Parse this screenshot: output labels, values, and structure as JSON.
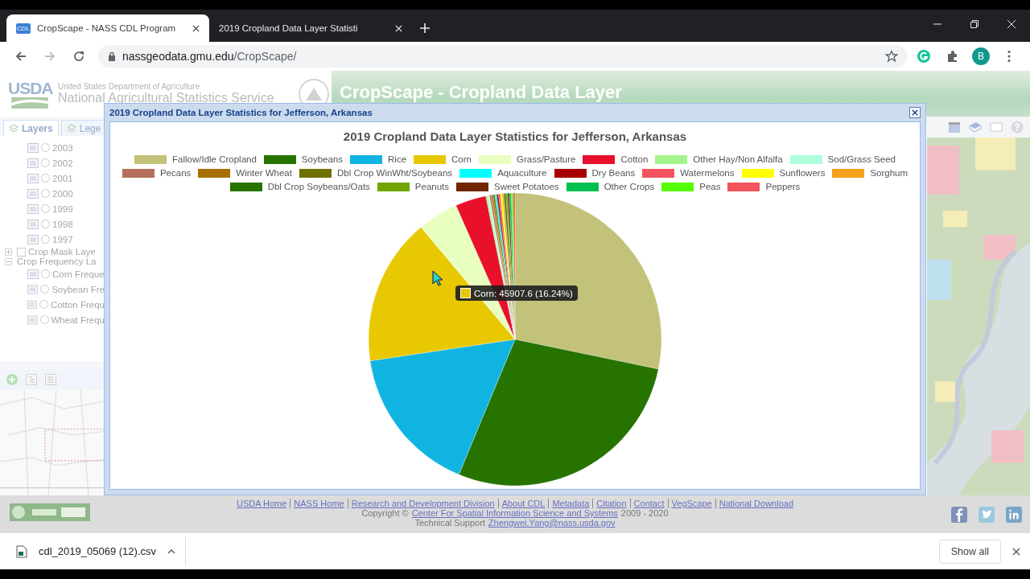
{
  "browser": {
    "tabs": [
      {
        "title": "CropScape - NASS CDL Program",
        "selected": true,
        "favicon": "CDL"
      },
      {
        "title": "2019 Cropland Data Layer Statisti",
        "selected": false
      }
    ],
    "url": {
      "host": "nassgeodata.gmu.edu",
      "path": "/CropScape/"
    },
    "profile_initial": "B"
  },
  "page": {
    "logo": "USDA",
    "agency": "United States Department of Agriculture",
    "service": "National Agricultural Statistics Service",
    "app_title": "CropScape - Cropland Data Layer",
    "panel_tabs": [
      {
        "label": "Layers",
        "selected": true
      },
      {
        "label": "Lege",
        "selected": false
      }
    ],
    "layers": [
      {
        "kind": "layer",
        "label": "2003",
        "checked": false
      },
      {
        "kind": "layer",
        "label": "2002",
        "checked": false
      },
      {
        "kind": "layer",
        "label": "2001",
        "checked": false
      },
      {
        "kind": "layer",
        "label": "2000",
        "checked": false
      },
      {
        "kind": "layer",
        "label": "1999",
        "checked": false
      },
      {
        "kind": "layer",
        "label": "1998",
        "checked": false
      },
      {
        "kind": "layer",
        "label": "1997",
        "checked": false
      },
      {
        "kind": "folder",
        "label": "Crop Mask Laye",
        "expanded": false,
        "checked": false
      },
      {
        "kind": "folder",
        "label": "Crop Frequency La",
        "expanded": true,
        "children": [
          {
            "kind": "layer",
            "label": "Corn Freque",
            "checked": false
          },
          {
            "kind": "layer",
            "label": "Soybean Fre",
            "checked": false
          },
          {
            "kind": "layer",
            "label": "Cotton Frequ",
            "checked": false
          },
          {
            "kind": "layer",
            "label": "Wheat Frequ",
            "checked": false
          }
        ]
      }
    ],
    "footer": {
      "links": [
        "USDA Home",
        "NASS Home",
        "Research and Development Division",
        "About CDL",
        "Metadata",
        "Citation",
        "Contact",
        "VegScape",
        "National Download"
      ],
      "copyright": "Copyright ©",
      "copyright_link": "Center For Spatial Information Science and Systems",
      "years": "2009 - 2020",
      "support": "Technical Support",
      "support_email": "Zhengwei.Yang@nass.usda.gov"
    }
  },
  "dialog": {
    "title": "2019 Cropland Data Layer Statistics for Jefferson, Arkansas",
    "chart_data": {
      "type": "pie",
      "title": "2019 Cropland Data Layer Statistics for Jefferson, Arkansas",
      "categories": [
        "Fallow/Idle Cropland",
        "Soybeans",
        "Rice",
        "Corn",
        "Grass/Pasture",
        "Cotton",
        "Other Hay/Non Alfalfa",
        "Sod/Grass Seed",
        "Pecans",
        "Winter Wheat",
        "Dbl Crop WinWht/Soybeans",
        "Aquaculture",
        "Dry Beans",
        "Watermelons",
        "Sunflowers",
        "Sorghum",
        "Dbl Crop Soybeans/Oats",
        "Peanuts",
        "Sweet Potatoes",
        "Other Crops",
        "Peas",
        "Peppers"
      ],
      "values": [
        28.26,
        28.0,
        16.4,
        16.24,
        4.5,
        3.4,
        0.2,
        0.2,
        0.2,
        0.2,
        0.2,
        0.2,
        0.2,
        0.2,
        0.2,
        0.2,
        0.2,
        0.2,
        0.2,
        0.2,
        0.2,
        0.2
      ],
      "legend": "top",
      "colors": [
        "#c2c27a",
        "#267300",
        "#10b4e0",
        "#e8c800",
        "#e8ffbf",
        "#e8102a",
        "#a5f58d",
        "#afffdd",
        "#b5705b",
        "#a87000",
        "#707000",
        "#00ffff",
        "#a80000",
        "#f2535d",
        "#ffff00",
        "#f5a01a",
        "#267300",
        "#70a500",
        "#702600",
        "#00c050",
        "#54ff00",
        "#f2535d"
      ]
    },
    "tooltip": {
      "text": "Corn: 45907.6 (16.24%)",
      "color": "#e8c800"
    }
  },
  "downloads": {
    "file": "cdl_2019_05069 (12).csv",
    "show_all": "Show all"
  }
}
